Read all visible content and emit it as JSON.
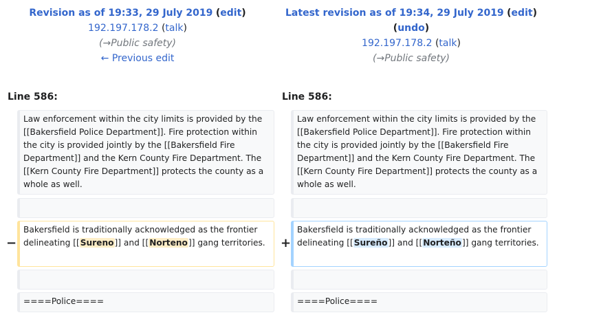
{
  "left_header": {
    "title": "Revision as of 19:33, 29 July 2019",
    "edit_label": "edit",
    "user": "192.197.178.2",
    "talk_label": "talk",
    "summary": "(→Public safety)",
    "prev_edit": "← Previous edit"
  },
  "right_header": {
    "title": "Latest revision as of 19:34, 29 July 2019",
    "edit_label": "edit",
    "undo_label": "undo",
    "user": "192.197.178.2",
    "talk_label": "talk",
    "summary": "(→Public safety)"
  },
  "line_label": "Line 586:",
  "context_paragraph": "Law enforcement within the city limits is provided by the [[Bakersfield Police Department]]. Fire protection within the city is provided jointly by the [[Bakersfield Fire Department]] and the Kern County Fire Department. The [[Kern County Fire Department]] protects the county as a whole as well.",
  "removed": {
    "marker": "−",
    "before": "Bakersfield is traditionally acknowledged as the frontier delineating [[",
    "word1": "Sureno",
    "mid": "]] and [[",
    "word2": "Norteno",
    "after": "]] gang territories."
  },
  "added": {
    "marker": "+",
    "before": "Bakersfield is traditionally acknowledged as the frontier delineating [[",
    "word1": "Sureño",
    "mid": "]] and [[",
    "word2": "Norteño",
    "after": "]] gang territories."
  },
  "context_heading": "====Police===="
}
